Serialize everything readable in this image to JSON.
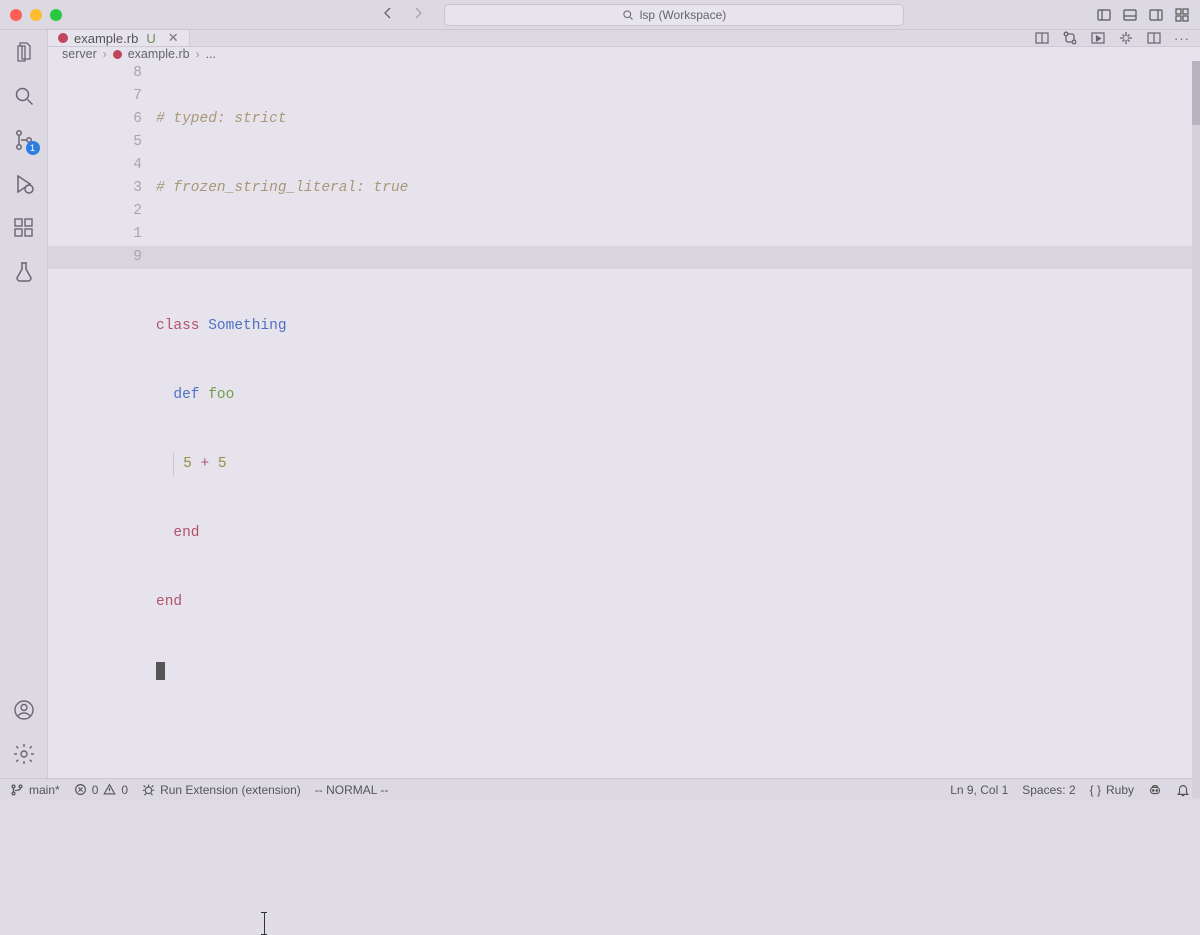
{
  "title": {
    "search_placeholder": "lsp (Workspace)"
  },
  "activity": {
    "scm_badge": "1"
  },
  "tab": {
    "filename": "example.rb",
    "modified_marker": "U"
  },
  "breadcrumbs": {
    "root": "server",
    "file": "example.rb",
    "tail": "..."
  },
  "gutter": [
    "8",
    "7",
    "6",
    "5",
    "4",
    "3",
    "2",
    "1",
    "9"
  ],
  "code": {
    "l1_comment": "# typed: strict",
    "l2_comment": "# frozen_string_literal: true",
    "l4_class": "class",
    "l4_name": "Something",
    "l5_def": "def",
    "l5_method": "foo",
    "l6_lhs": "5",
    "l6_op": "+",
    "l6_rhs": "5",
    "l7_end": "end",
    "l8_end": "end"
  },
  "status": {
    "branch": "main*",
    "errors": "0",
    "warnings": "0",
    "run_label": "Run Extension (extension)",
    "vim_mode": "-- NORMAL --",
    "cursor": "Ln 9, Col 1",
    "spaces": "Spaces: 2",
    "lang_brackets": "{ }",
    "language": "Ruby"
  }
}
